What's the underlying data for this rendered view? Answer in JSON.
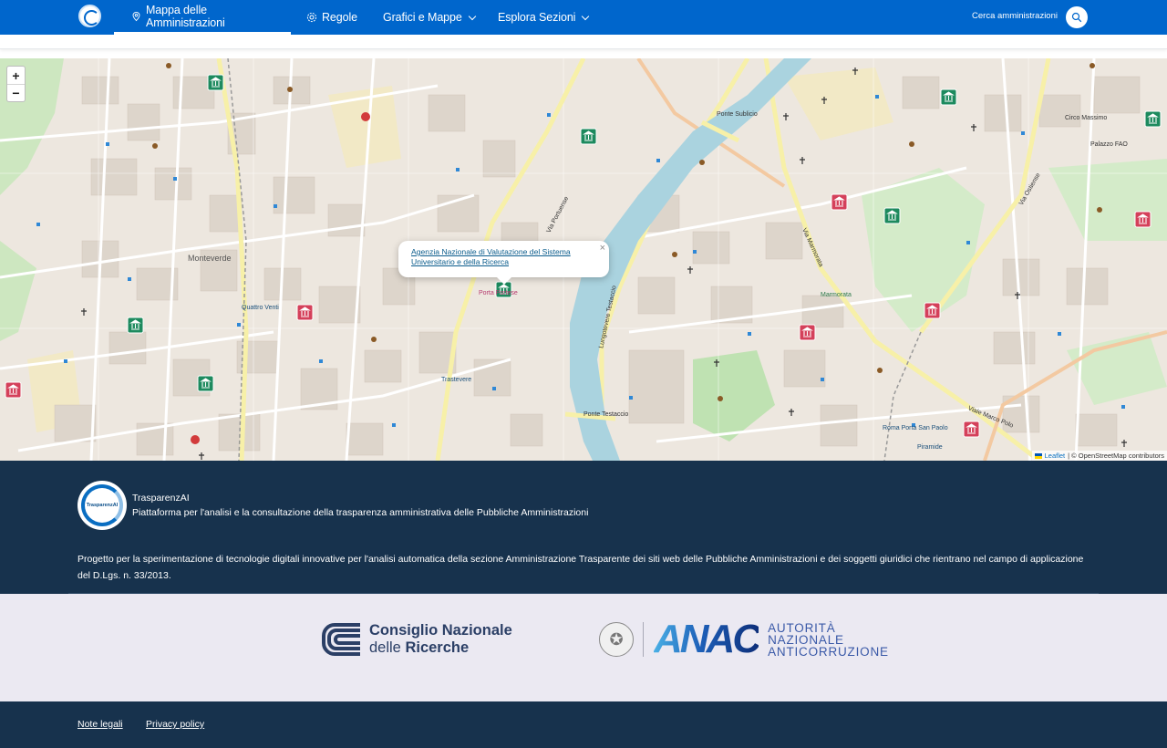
{
  "navbar": {
    "items": [
      {
        "label": "Mappa delle Amministrazioni",
        "icon": "map-pin-icon",
        "active": true
      },
      {
        "label": "Regole",
        "icon": "gear-icon"
      },
      {
        "label": "Grafici e Mappe",
        "icon": "chevron-down-icon"
      },
      {
        "label": "Esplora Sezioni",
        "icon": "chevron-down-icon"
      }
    ],
    "search_label": "Cerca amministrazioni"
  },
  "map": {
    "zoom_in": "+",
    "zoom_out": "−",
    "popup": {
      "link": "Agenzia Nazionale di Valutazione del Sistema Universitario e della Ricerca",
      "close": "×"
    },
    "labels": [
      "Monteverde",
      "Quattro Venti",
      "Trastevere",
      "Porta Portese",
      "Ponte Testaccio",
      "Ponte Sublicio",
      "Marmorata",
      "Piramide",
      "Roma Porta San Paolo",
      "Circo Massimo",
      "Palazzo FAO",
      "Via Portuense",
      "Lungotevere Testaccio",
      "Viale Marco Polo",
      "Via Ostiense",
      "Via Marmorata"
    ],
    "attribution": {
      "leaflet": "Leaflet",
      "osm": "| © OpenStreetMap contributors"
    }
  },
  "footer": {
    "title": "TrasparenzAI",
    "logo_text": "TrasparenzAI",
    "subtitle": "Piattaforma per l'analisi e la consultazione della trasparenza amministrativa delle Pubbliche Amministrazioni",
    "description": "Progetto per la sperimentazione di tecnologie digitali innovative per l'analisi automatica della sezione Amministrazione Trasparente dei siti web delle Pubbliche Amministrazioni e dei soggetti giuridici che rientrano nel campo di applicazione del D.Lgs. n. 33/2013."
  },
  "partners": {
    "cnr": {
      "line1": "Consiglio Nazionale",
      "line2a": "delle ",
      "line2b": "Ricerche"
    },
    "anac": {
      "word": "ANAC",
      "line1": "AUTORITÀ",
      "line2": "NAZIONALE",
      "line3": "ANTICORRUZIONE"
    }
  },
  "bottom_links": {
    "legal": "Note legali",
    "privacy": "Privacy policy"
  },
  "colors": {
    "primary": "#0066cc",
    "footer": "#17324d",
    "partners_bg": "#ebe9f2",
    "marker_green": "#1d8a5e",
    "marker_red": "#d4405a"
  }
}
